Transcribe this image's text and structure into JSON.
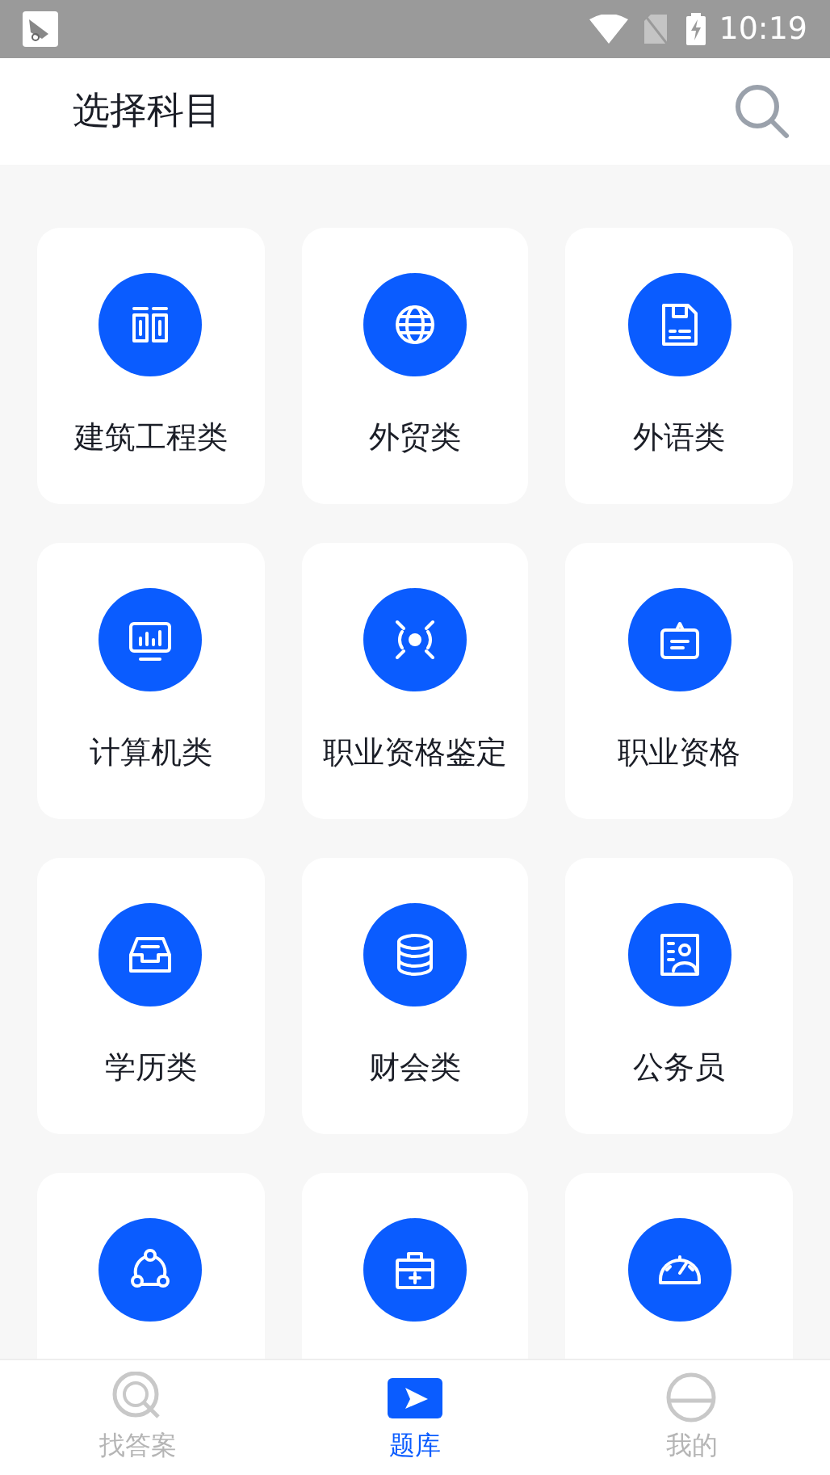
{
  "status_bar": {
    "time": "10:19"
  },
  "header": {
    "title": "选择科目"
  },
  "subjects": [
    {
      "kind": "labeled",
      "label": "建筑工程类"
    },
    {
      "kind": "labeled",
      "label": "外贸类"
    },
    {
      "kind": "labeled",
      "label": "外语类"
    },
    {
      "kind": "labeled",
      "label": "计算机类"
    },
    {
      "kind": "labeled",
      "label": "职业资格鉴定"
    },
    {
      "kind": "labeled",
      "label": "职业资格"
    },
    {
      "kind": "labeled",
      "label": "学历类"
    },
    {
      "kind": "labeled",
      "label": "财会类"
    },
    {
      "kind": "labeled",
      "label": "公务员"
    },
    {
      "kind": "clipped"
    },
    {
      "kind": "clipped"
    },
    {
      "kind": "clipped"
    }
  ],
  "tabs": [
    {
      "label": "找答案",
      "selected": false
    },
    {
      "label": "题库",
      "selected": true
    },
    {
      "label": "我的",
      "selected": false
    }
  ]
}
